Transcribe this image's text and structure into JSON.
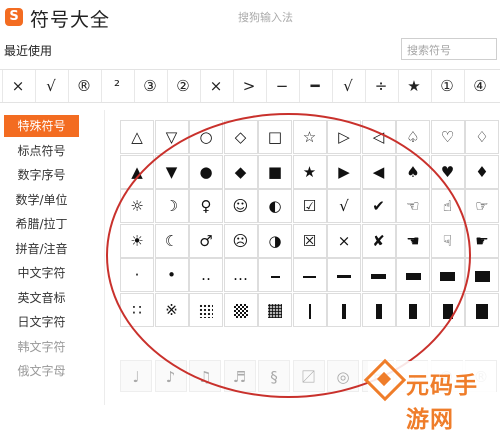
{
  "window": {
    "logo_char": "S",
    "title": "符号大全",
    "center_title": "搜狗输入法"
  },
  "recent": {
    "label": "最近使用",
    "symbols": [
      "×",
      "√",
      "®",
      "²",
      "③",
      "②",
      "×",
      ">",
      "−",
      "━",
      "√",
      "÷",
      "★",
      "①",
      "④"
    ]
  },
  "search": {
    "placeholder": "搜索符号"
  },
  "sidebar": {
    "items": [
      {
        "label": "特殊符号",
        "active": true
      },
      {
        "label": "标点符号",
        "active": false
      },
      {
        "label": "数字序号",
        "active": false
      },
      {
        "label": "数学/单位",
        "active": false
      },
      {
        "label": "希腊/拉丁",
        "active": false
      },
      {
        "label": "拼音/注音",
        "active": false
      },
      {
        "label": "中文字符",
        "active": false
      },
      {
        "label": "英文音标",
        "active": false
      },
      {
        "label": "日文字符",
        "active": false
      },
      {
        "label": "韩文字符",
        "active": false
      },
      {
        "label": "俄文字母",
        "active": false
      }
    ],
    "accent_color": "#f36c21"
  },
  "grid": {
    "rows": [
      [
        "△",
        "▽",
        "○",
        "◇",
        "□",
        "☆",
        "▷",
        "◁",
        "♤",
        "♡",
        "♢"
      ],
      [
        "▲",
        "▼",
        "●",
        "◆",
        "■",
        "★",
        "▶",
        "◀",
        "♠",
        "♥",
        "♦"
      ],
      [
        "☼",
        "☽",
        "♀",
        "☺",
        "◐",
        "☑",
        "√",
        "✔",
        "☜",
        "☝",
        "☞"
      ],
      [
        "☀",
        "☾",
        "♂",
        "☹",
        "◑",
        "☒",
        "×",
        "✘",
        "☚",
        "☟",
        "☛"
      ],
      [
        "·",
        "•",
        "‥",
        "…",
        "bar1",
        "bar2",
        "bar3",
        "bar4",
        "bar5",
        "bar6",
        "bar7"
      ],
      [
        "∷",
        "※",
        "dots1",
        "checker",
        "dots2",
        "vbar1",
        "vbar2",
        "vbar3",
        "vbar4",
        "vbar5",
        "vbar6"
      ]
    ]
  },
  "bottom_row": {
    "symbols": [
      "♩",
      "♪",
      "♫",
      "♬",
      "§",
      "〼",
      "◎",
      "¤",
      "۞",
      "℗",
      "®"
    ]
  },
  "annotation": {
    "color": "#c9312c"
  },
  "watermark": {
    "text": "元码手游网",
    "color": "#ef7d2a"
  }
}
